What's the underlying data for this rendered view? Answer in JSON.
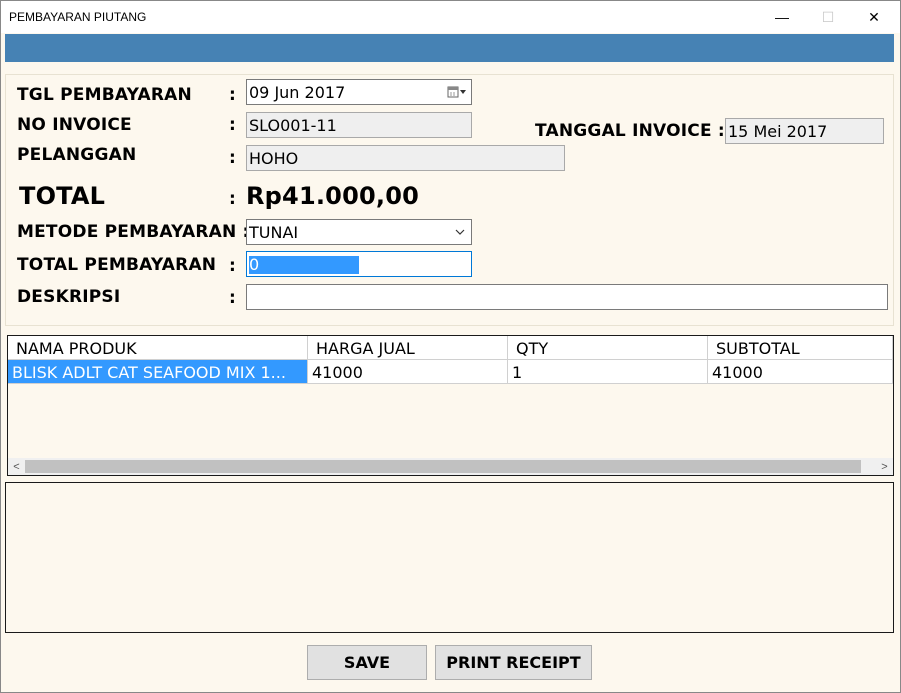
{
  "window": {
    "title": "PEMBAYARAN PIUTANG",
    "minimize": "—",
    "maximize": "☐",
    "close": "✕"
  },
  "form": {
    "tgl_label": "TGL PEMBAYARAN",
    "tgl_value": "09  Jun  2017",
    "invoice_label": "NO INVOICE",
    "invoice_value": "SLO001-11",
    "tanggal_invoice_label": "TANGGAL INVOICE :",
    "tanggal_invoice_value": "15 Mei 2017",
    "pelanggan_label": "PELANGGAN",
    "pelanggan_value": "HOHO",
    "total_label": "TOTAL",
    "total_value": "Rp41.000,00",
    "metode_label": "METODE PEMBAYARAN :",
    "metode_value": "TUNAI",
    "total_pembayaran_label": "TOTAL PEMBAYARAN",
    "total_pembayaran_value": "0",
    "deskripsi_label": "DESKRIPSI",
    "deskripsi_value": "",
    "colon": ":"
  },
  "grid": {
    "columns": [
      "NAMA PRODUK",
      "HARGA JUAL",
      "QTY",
      "SUBTOTAL"
    ],
    "rows": [
      [
        "BLISK ADLT CAT SEAFOOD MIX 1...",
        "41000",
        "1",
        "41000"
      ]
    ],
    "scroll_left": "<",
    "scroll_right": ">"
  },
  "buttons": {
    "save": "SAVE",
    "print": "PRINT RECEIPT"
  },
  "colors": {
    "accent_bar": "#4682b4",
    "selection": "#3399ff",
    "background": "#fdf8ee"
  }
}
